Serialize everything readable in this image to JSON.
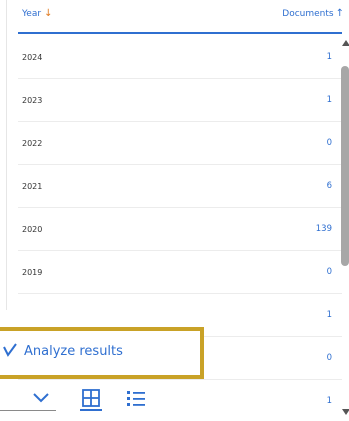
{
  "table": {
    "col_year": "Year",
    "col_documents": "Documents",
    "rows": [
      {
        "year": "2024",
        "documents": "1"
      },
      {
        "year": "2023",
        "documents": "1"
      },
      {
        "year": "2022",
        "documents": "0"
      },
      {
        "year": "2021",
        "documents": "6"
      },
      {
        "year": "2020",
        "documents": "139"
      },
      {
        "year": "2019",
        "documents": "0"
      },
      {
        "year": "",
        "documents": "1"
      },
      {
        "year": "",
        "documents": "0"
      },
      {
        "year": "",
        "documents": "1"
      }
    ]
  },
  "analyze": {
    "label": "Analyze results"
  },
  "icons": {
    "sort_desc": "arrow-down-icon",
    "sort_asc": "arrow-up-icon",
    "check": "check-icon",
    "chevron": "chevron-down-icon",
    "grid": "grid-view-icon",
    "list": "list-view-icon"
  },
  "colors": {
    "accent": "#2f6fd0",
    "sort": "#e07a20",
    "highlight": "#c9a227"
  }
}
